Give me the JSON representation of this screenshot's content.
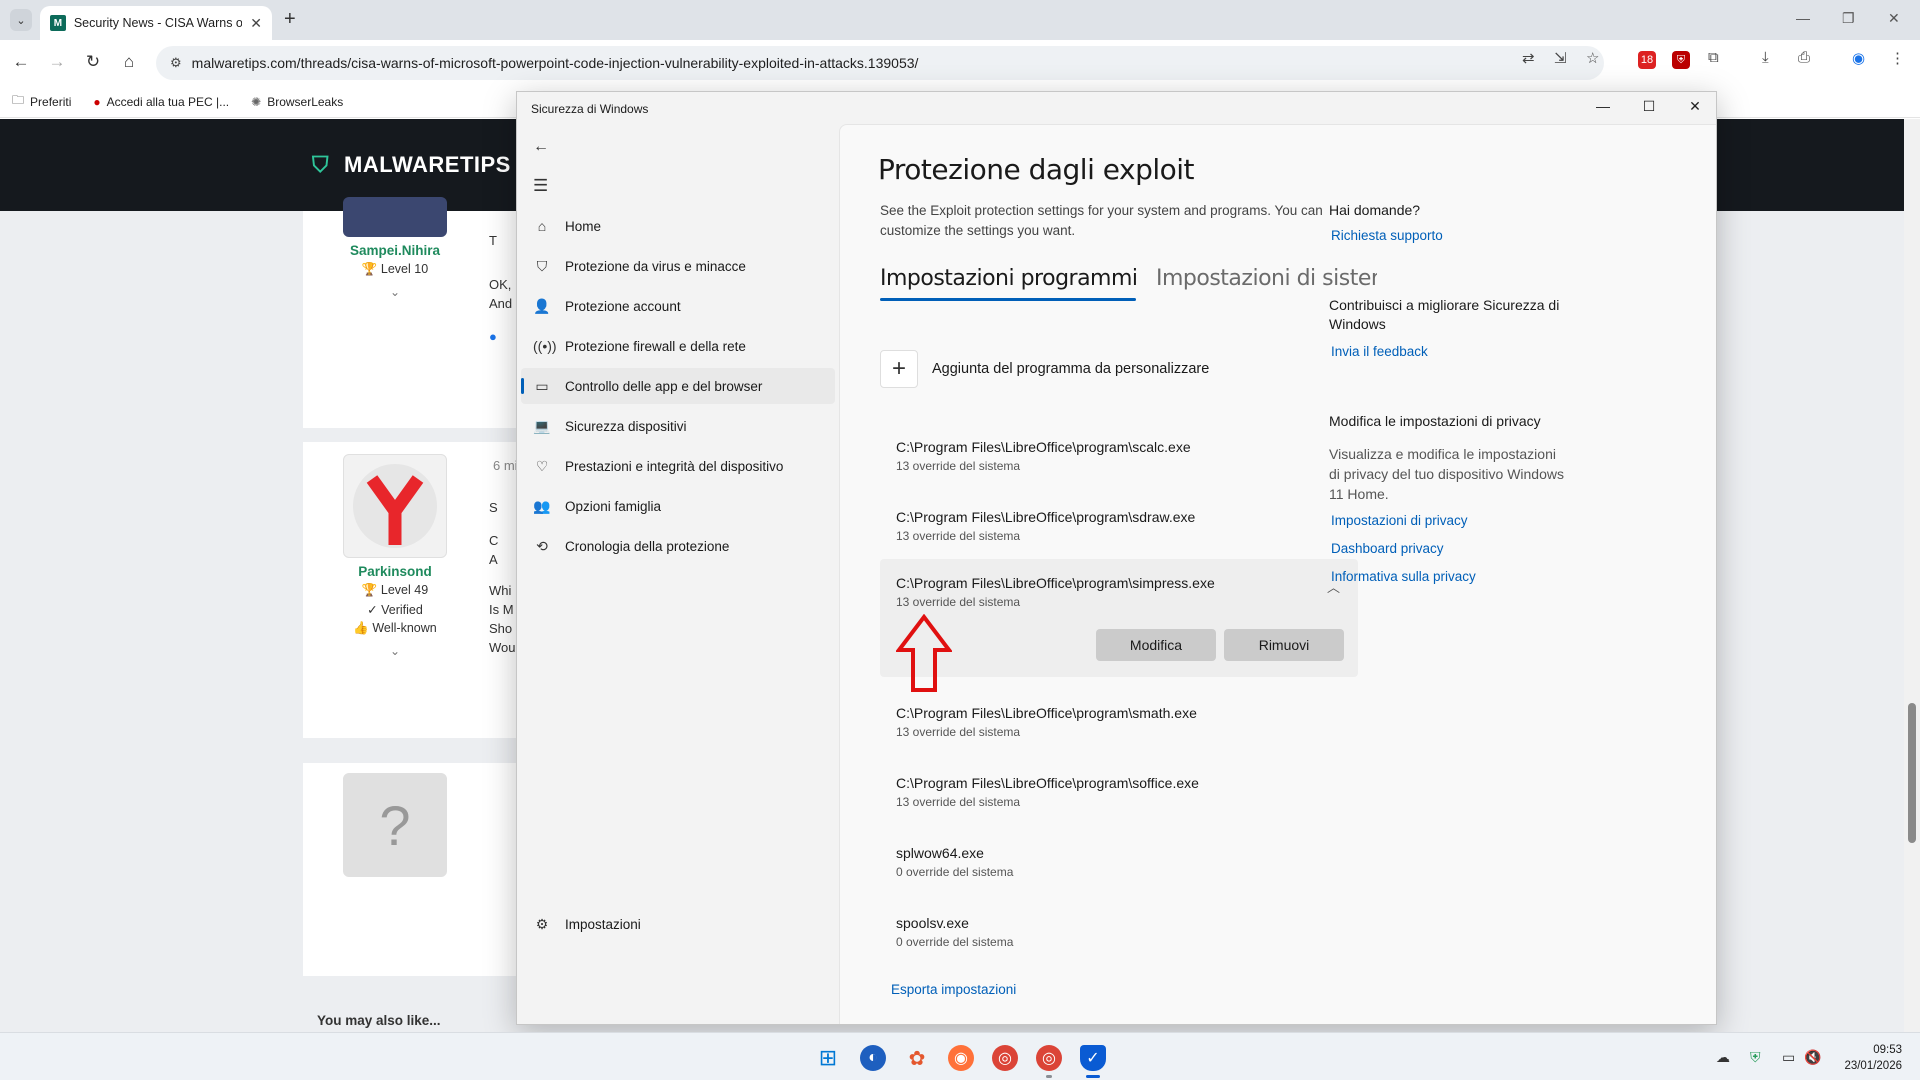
{
  "browser": {
    "tab_title": "Security News - CISA Warns of",
    "url": "malwaretips.com/threads/cisa-warns-of-microsoft-powerpoint-code-injection-vulnerability-exploited-in-attacks.139053/",
    "bookmarks": [
      "Preferiti",
      "Accedi alla tua PEC |...",
      "BrowserLeaks"
    ],
    "extension_badge": "18"
  },
  "site": {
    "logo": "MALWARETIPS",
    "posts": [
      {
        "username": "Sampei.Nihira",
        "level": "Level 10",
        "snippet_lines": [
          "T",
          "OK,",
          "And"
        ]
      },
      {
        "username": "Parkinsond",
        "level": "Level 49",
        "verified": "Verified",
        "known": "Well-known",
        "time": "6 mi",
        "snippet_lines": [
          "S",
          "C",
          "A",
          "Whi",
          "Is M",
          "Sho",
          "Wou"
        ]
      },
      {
        "avatar_text": "?"
      }
    ],
    "also_like": "You may also like..."
  },
  "window": {
    "title": "Sicurezza di Windows",
    "nav": [
      {
        "label": "Home",
        "icon": "home-icon"
      },
      {
        "label": "Protezione da virus e minacce",
        "icon": "shield-icon"
      },
      {
        "label": "Protezione account",
        "icon": "person-icon"
      },
      {
        "label": "Protezione firewall e della rete",
        "icon": "antenna-icon"
      },
      {
        "label": "Controllo delle app e del browser",
        "icon": "browser-icon"
      },
      {
        "label": "Sicurezza dispositivi",
        "icon": "laptop-icon"
      },
      {
        "label": "Prestazioni e integrità del dispositivo",
        "icon": "heart-icon"
      },
      {
        "label": "Opzioni famiglia",
        "icon": "family-icon"
      },
      {
        "label": "Cronologia della protezione",
        "icon": "history-icon"
      }
    ],
    "settings_label": "Impostazioni",
    "page_title": "Protezione dagli exploit",
    "page_desc": "See the Exploit protection settings for your system and programs. You can customize the settings you want.",
    "tab_programs": "Impostazioni programmi",
    "tab_system": "Impostazioni di sistema",
    "add_program": "Aggiunta del programma da personalizzare",
    "programs": [
      {
        "name": "C:\\Program Files\\LibreOffice\\program\\scalc.exe",
        "overrides": "13 override del sistema"
      },
      {
        "name": "C:\\Program Files\\LibreOffice\\program\\sdraw.exe",
        "overrides": "13 override del sistema"
      },
      {
        "name": "C:\\Program Files\\LibreOffice\\program\\simpress.exe",
        "overrides": "13 override del sistema"
      },
      {
        "name": "C:\\Program Files\\LibreOffice\\program\\smath.exe",
        "overrides": "13 override del sistema"
      },
      {
        "name": "C:\\Program Files\\LibreOffice\\program\\soffice.exe",
        "overrides": "13 override del sistema"
      },
      {
        "name": "splwow64.exe",
        "overrides": "0 override del sistema"
      },
      {
        "name": "spoolsv.exe",
        "overrides": "0 override del sistema"
      }
    ],
    "btn_edit": "Modifica",
    "btn_remove": "Rimuovi",
    "export": "Esporta impostazioni",
    "side": {
      "questions": "Hai domande?",
      "support": "Richiesta supporto",
      "improve": "Contribuisci a migliorare Sicurezza di Windows",
      "feedback": "Invia il feedback",
      "privacy_head": "Modifica le impostazioni di privacy",
      "privacy_text": "Visualizza e modifica le impostazioni di privacy del tuo dispositivo Windows 11 Home.",
      "privacy_settings": "Impostazioni di privacy",
      "privacy_dashboard": "Dashboard privacy",
      "privacy_policy": "Informativa sulla privacy"
    }
  },
  "taskbar": {
    "time": "09:53",
    "date": "23/01/2026"
  },
  "colors": {
    "accent": "#005fb8",
    "arrow": "#e01010",
    "site_header": "#15191e"
  }
}
